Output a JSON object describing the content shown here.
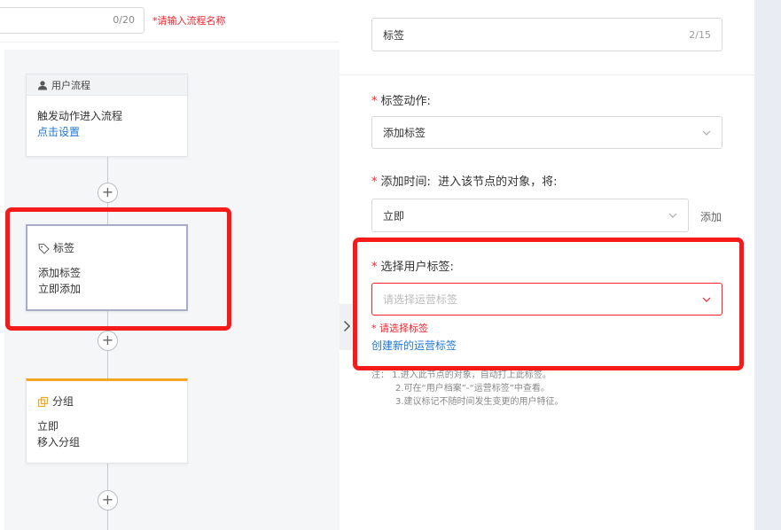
{
  "flow_name_input": {
    "counter": "0/20",
    "hint": "*请输入流程名称"
  },
  "nodes": {
    "user_flow": {
      "header": "用户流程",
      "text": "触发动作进入流程",
      "link": "点击设置"
    },
    "tag": {
      "title": "标签",
      "line1": "添加标签",
      "line2": "立即添加"
    },
    "group": {
      "title": "分组",
      "line1": "立即",
      "line2": "移入分组"
    }
  },
  "panel": {
    "name_field": {
      "value": "标签",
      "counter": "2/15"
    },
    "tag_action": {
      "label": "标签动作:",
      "value": "添加标签"
    },
    "add_time": {
      "label": "添加时间:",
      "desc": "进入该节点的对象，将:",
      "value": "立即",
      "add_label": "添加"
    },
    "user_tag": {
      "label": "选择用户标签:",
      "placeholder": "请选择运营标签",
      "error": "* 请选择标签",
      "create_link": "创建新的运营标签"
    },
    "notes": [
      "注：  1.进入此节点的对象，自动打上此标签。",
      "2.可在“用户档案”-“运营标签”中查看。",
      "3.建议标记不随时间发生变更的用户特征。"
    ]
  },
  "colors": {
    "accent": "#1e76d6",
    "error": "#f5222d",
    "highlight": "#f51b1b",
    "group_accent": "#f5a623"
  }
}
